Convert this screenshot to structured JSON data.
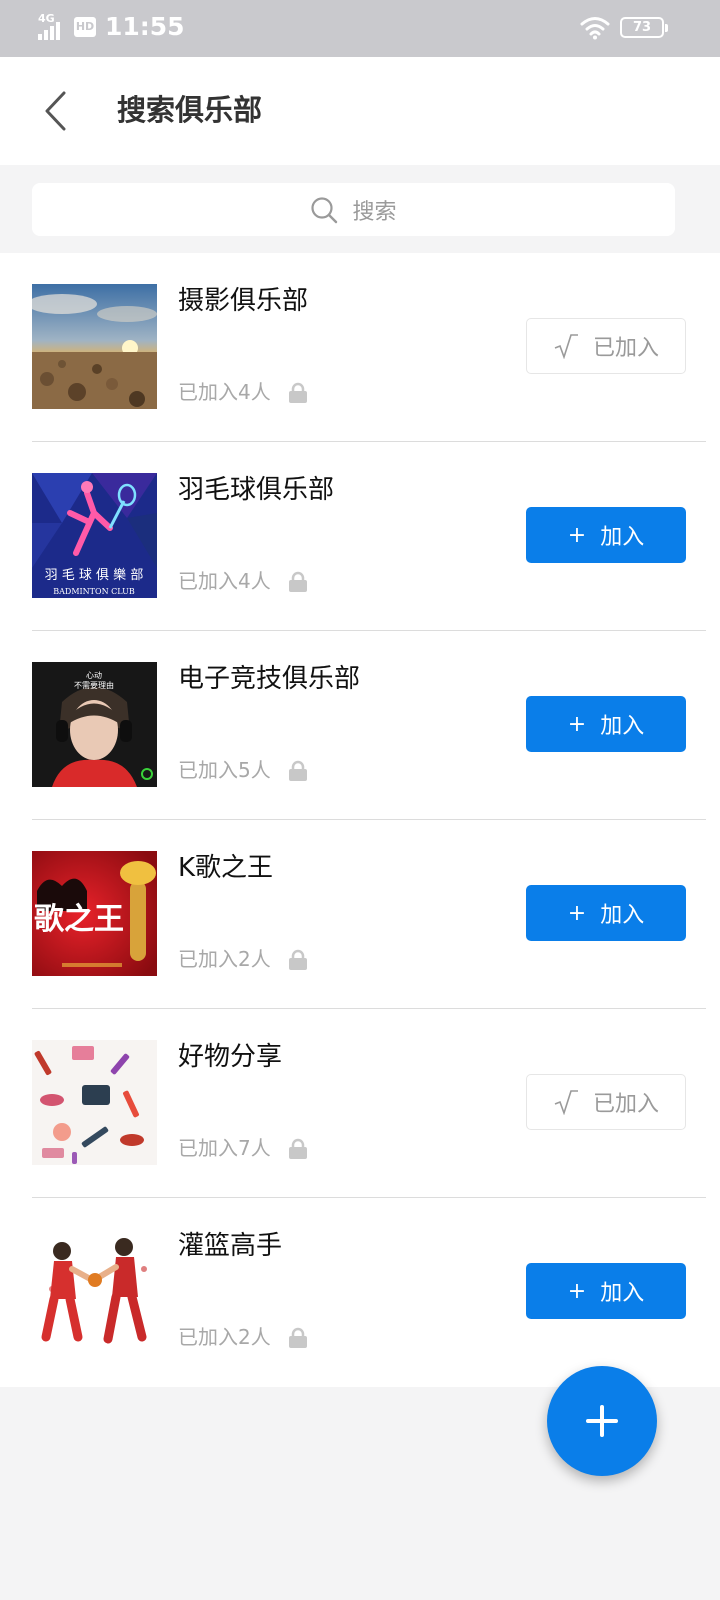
{
  "status_bar": {
    "time": "11:55",
    "network": "4G",
    "hd": "HD",
    "battery": "73"
  },
  "header": {
    "title": "搜索俱乐部"
  },
  "search": {
    "placeholder": "搜索"
  },
  "clubs": [
    {
      "name": "摄影俱乐部",
      "members": "已加入4人",
      "button": "已加入",
      "status": "joined",
      "thumb": "sunset-beach-photo"
    },
    {
      "name": "羽毛球俱乐部",
      "members": "已加入4人",
      "button": "加入",
      "status": "open",
      "thumb": "badminton-club-poster",
      "thumb_text": "羽 毛 球 俱 樂 部",
      "thumb_subtext": "BADMINTON CLUB"
    },
    {
      "name": "电子竞技俱乐部",
      "members": "已加入5人",
      "button": "加入",
      "status": "open",
      "thumb": "gamer-with-headphones-photo",
      "thumb_text": "心动\n不需要理由"
    },
    {
      "name": "K歌之王",
      "members": "已加入2人",
      "button": "加入",
      "status": "open",
      "thumb": "karaoke-king-poster",
      "thumb_text": "歌之王"
    },
    {
      "name": "好物分享",
      "members": "已加入7人",
      "button": "已加入",
      "status": "joined",
      "thumb": "cosmetics-pattern-illustration"
    },
    {
      "name": "灌篮高手",
      "members": "已加入2人",
      "button": "加入",
      "status": "open",
      "thumb": "basketball-players-illustration"
    }
  ],
  "colors": {
    "primary": "#0a7ee9",
    "muted_text": "#a8a8a8",
    "background": "#f4f4f5",
    "status_bar": "#c9c9cd"
  }
}
